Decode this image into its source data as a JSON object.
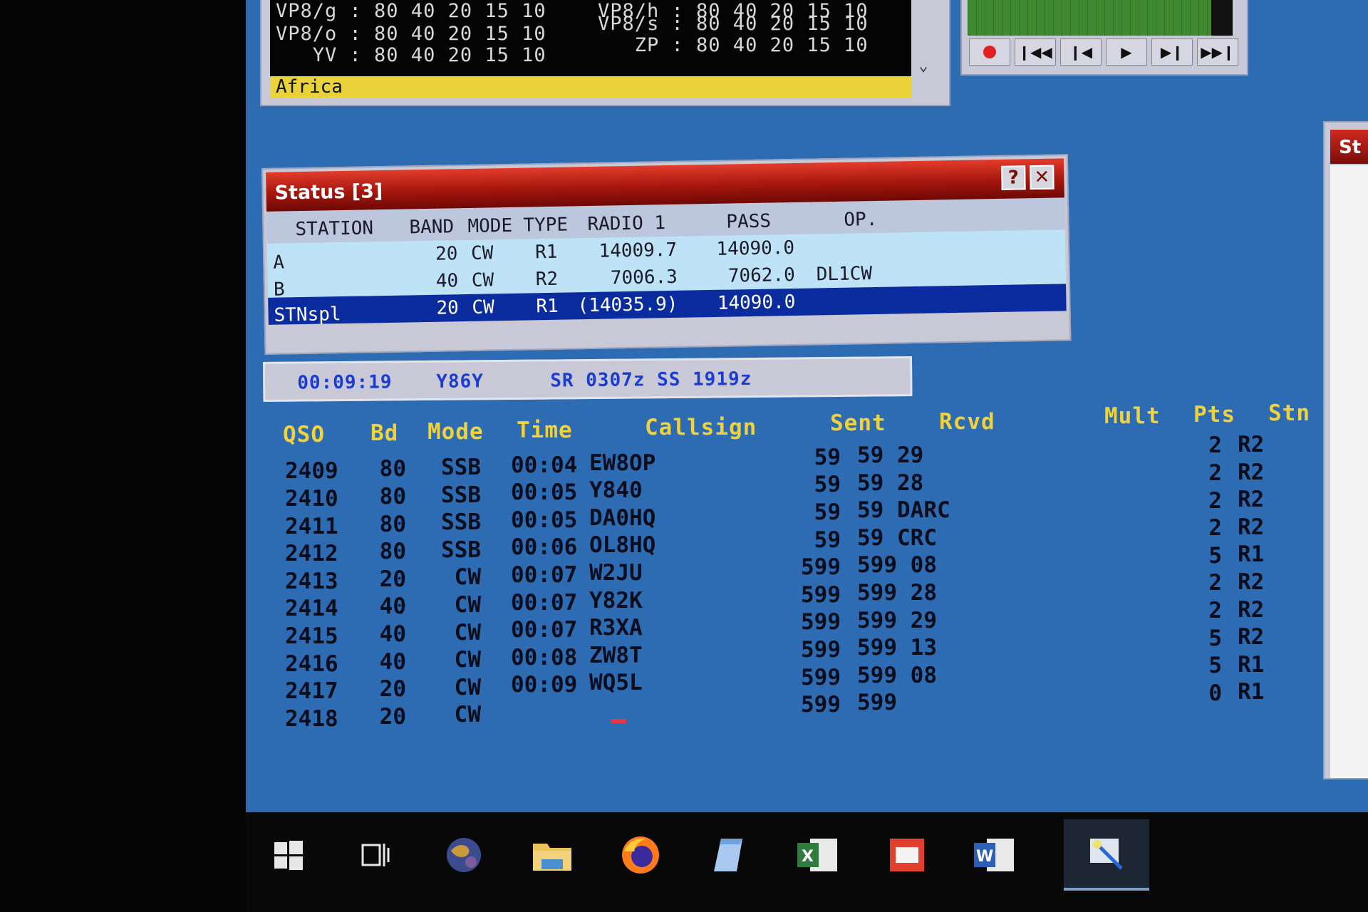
{
  "bandmap": {
    "rows": [
      {
        "left": "VP8/g : 80 40 20 15 10",
        "right": "VP8/h : 80 40 20 15 10"
      },
      {
        "left": "VP8/o : 80 40 20 15 10",
        "right": "VP8/s : 80 40 20 15 10"
      },
      {
        "left": "   YV : 80 40 20 15 10",
        "right": "   ZP : 80 40 20 15 10"
      }
    ],
    "region": "Africa"
  },
  "status": {
    "title": "Status [3]",
    "headers": {
      "station": "STATION",
      "band": "BAND",
      "mode": "MODE",
      "type": "TYPE",
      "radio": "RADIO 1",
      "pass": "PASS",
      "op": "OP."
    },
    "rows": [
      {
        "station": "A",
        "band": "20",
        "mode": "CW",
        "type": "R1",
        "radio": "14009.7",
        "pass": "14090.0",
        "op": ""
      },
      {
        "station": "B",
        "band": "40",
        "mode": "CW",
        "type": "R2",
        "radio": "7006.3",
        "pass": "7062.0",
        "op": "DL1CW"
      },
      {
        "station": "STNspl",
        "band": "20",
        "mode": "CW",
        "type": "R1",
        "radio": "(14035.9)",
        "pass": "14090.0",
        "op": ""
      }
    ]
  },
  "infobar": {
    "elapsed": "00:09:19",
    "call": "Y86Y",
    "sun": "SR 0307z SS 1919z"
  },
  "log": {
    "headers": {
      "qso": "QSO",
      "bd": "Bd",
      "mode": "Mode",
      "time": "Time",
      "call": "Callsign",
      "sent": "Sent",
      "rcvd": "Rcvd",
      "mult": "Mult",
      "pts": "Pts",
      "stn": "Stn"
    },
    "rows": [
      {
        "qso": "2409",
        "bd": "80",
        "mode": "SSB",
        "time": "00:04",
        "call": "EW8OP",
        "sent": "59",
        "rcvd": "59 29",
        "pts": "2",
        "stn": "R2"
      },
      {
        "qso": "2410",
        "bd": "80",
        "mode": "SSB",
        "time": "00:05",
        "call": "Y840",
        "sent": "59",
        "rcvd": "59 28",
        "pts": "2",
        "stn": "R2"
      },
      {
        "qso": "2411",
        "bd": "80",
        "mode": "SSB",
        "time": "00:05",
        "call": "DA0HQ",
        "sent": "59",
        "rcvd": "59 DARC",
        "pts": "2",
        "stn": "R2"
      },
      {
        "qso": "2412",
        "bd": "80",
        "mode": "SSB",
        "time": "00:06",
        "call": "OL8HQ",
        "sent": "59",
        "rcvd": "59 CRC",
        "pts": "2",
        "stn": "R2"
      },
      {
        "qso": "2413",
        "bd": "20",
        "mode": "CW",
        "time": "00:07",
        "call": "W2JU",
        "sent": "599",
        "rcvd": "599 08",
        "pts": "5",
        "stn": "R1"
      },
      {
        "qso": "2414",
        "bd": "40",
        "mode": "CW",
        "time": "00:07",
        "call": "Y82K",
        "sent": "599",
        "rcvd": "599 28",
        "pts": "2",
        "stn": "R2"
      },
      {
        "qso": "2415",
        "bd": "40",
        "mode": "CW",
        "time": "00:07",
        "call": "R3XA",
        "sent": "599",
        "rcvd": "599 29",
        "pts": "2",
        "stn": "R2"
      },
      {
        "qso": "2416",
        "bd": "40",
        "mode": "CW",
        "time": "00:08",
        "call": "ZW8T",
        "sent": "599",
        "rcvd": "599 13",
        "pts": "5",
        "stn": "R2"
      },
      {
        "qso": "2417",
        "bd": "20",
        "mode": "CW",
        "time": "00:09",
        "call": "WQ5L",
        "sent": "599",
        "rcvd": "599 08",
        "pts": "5",
        "stn": "R1"
      },
      {
        "qso": "2418",
        "bd": "20",
        "mode": "CW",
        "time": "",
        "call": "",
        "sent": "599",
        "rcvd": "599",
        "pts": "0",
        "stn": "R1"
      }
    ]
  },
  "right_window": {
    "caption": "St"
  },
  "taskbar": {
    "items": [
      {
        "name": "start-button",
        "icon": "windows-logo-icon"
      },
      {
        "name": "task-view-button",
        "icon": "task-view-icon"
      },
      {
        "name": "taskbar-app-globe",
        "icon": "globe-icon"
      },
      {
        "name": "taskbar-file-explorer",
        "icon": "folder-icon"
      },
      {
        "name": "taskbar-firefox",
        "icon": "firefox-icon"
      },
      {
        "name": "taskbar-notepad",
        "icon": "notepad-icon"
      },
      {
        "name": "taskbar-excel",
        "icon": "excel-icon"
      },
      {
        "name": "taskbar-acrobat",
        "icon": "pdf-icon"
      },
      {
        "name": "taskbar-word",
        "icon": "word-icon"
      },
      {
        "name": "taskbar-logger",
        "icon": "logger-icon"
      }
    ]
  }
}
